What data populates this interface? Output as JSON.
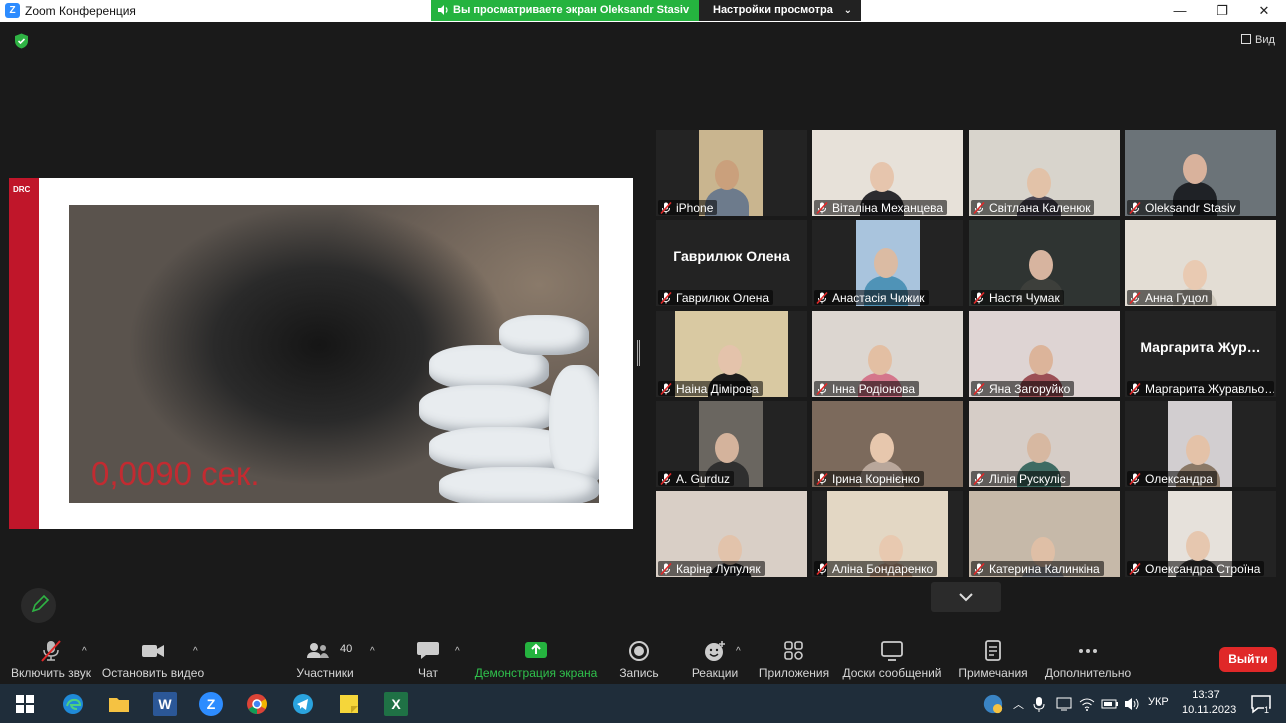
{
  "window": {
    "title": "Zoom Конференция",
    "minimize": "—",
    "maximize": "❐",
    "close": "✕"
  },
  "banner": {
    "text": "Вы просматриваете экран Oleksandr Stasiv",
    "settings_label": "Настройки просмотра",
    "settings_chevron": "⌄"
  },
  "view_label": "Вид",
  "slide": {
    "brand": "DRC",
    "timer": "0,0090 сек."
  },
  "participants": [
    {
      "name": "iPhone",
      "active": false
    },
    {
      "name": "Віталіна Механцева",
      "active": false
    },
    {
      "name": "Світлана Каленюк",
      "active": false
    },
    {
      "name": "Oleksandr Stasiv",
      "active": true
    },
    {
      "name": "Гаврилюк Олена",
      "card": "Гаврилюк Олена",
      "active": false
    },
    {
      "name": "Анастасія Чижик",
      "active": false
    },
    {
      "name": "Настя Чумак",
      "active": false
    },
    {
      "name": "Анна Гуцол",
      "active": false
    },
    {
      "name": "Наіна Дімірова",
      "active": false
    },
    {
      "name": "Інна Родіонова",
      "active": false
    },
    {
      "name": "Яна Загоруйко",
      "active": false
    },
    {
      "name": "Маргарита Журавльо…",
      "card": "Маргарита  Жур…",
      "active": false
    },
    {
      "name": "A. Gurduz",
      "active": false
    },
    {
      "name": "Ірина Корнієнко",
      "active": false
    },
    {
      "name": "Лілія Рускуліс",
      "active": false
    },
    {
      "name": "Олександра",
      "active": false
    },
    {
      "name": "Каріна Лупуляк",
      "active": false
    },
    {
      "name": "Аліна Бондаренко",
      "active": false
    },
    {
      "name": "Катерина Калинкіна",
      "active": false
    },
    {
      "name": "Олександра Строїна",
      "active": false
    }
  ],
  "toolbar": {
    "unmute": "Включить звук",
    "stop_video": "Остановить видео",
    "participants": "Участники",
    "participants_count": "40",
    "chat": "Чат",
    "share": "Демонстрация экрана",
    "record": "Запись",
    "reactions": "Реакции",
    "apps": "Приложения",
    "whiteboards": "Доски сообщений",
    "notes": "Примечания",
    "more": "Дополнительно",
    "leave": "Выйти",
    "caret": "^"
  },
  "taskbar": {
    "lang": "УКР",
    "time": "13:37",
    "date": "10.11.2023",
    "notify_count": "1",
    "excel": "X",
    "word": "W",
    "zoom": "Z"
  },
  "colors": {
    "accent_green": "#25b33f",
    "zoom_blue": "#2d8cff",
    "leave_red": "#e02828",
    "active_outline": "#d9e86a",
    "slide_red": "#c0162a"
  }
}
